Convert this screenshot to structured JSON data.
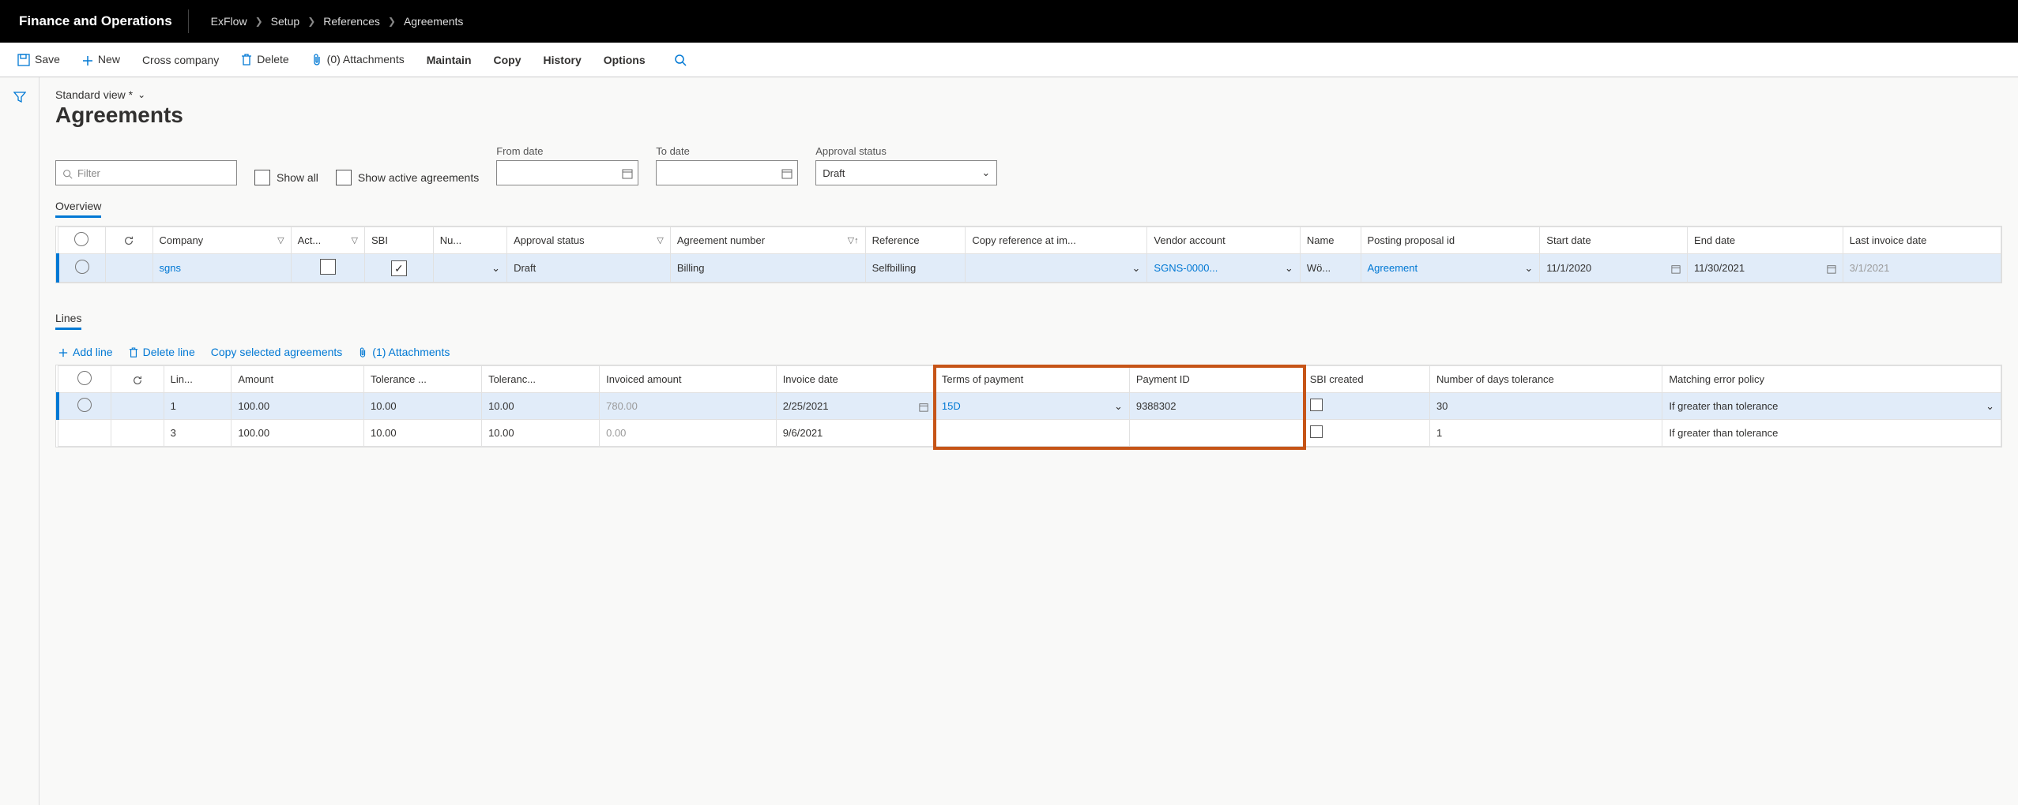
{
  "brand": "Finance and Operations",
  "breadcrumb": [
    "ExFlow",
    "Setup",
    "References",
    "Agreements"
  ],
  "actions": {
    "save": "Save",
    "new": "New",
    "cross_company": "Cross company",
    "delete": "Delete",
    "attachments": "(0) Attachments",
    "maintain": "Maintain",
    "copy": "Copy",
    "history": "History",
    "options": "Options"
  },
  "view_name": "Standard view *",
  "page_title": "Agreements",
  "filters": {
    "filter_placeholder": "Filter",
    "show_all": "Show all",
    "show_active": "Show active agreements",
    "from_date_label": "From date",
    "to_date_label": "To date",
    "approval_status_label": "Approval status",
    "approval_status_value": "Draft"
  },
  "overview": {
    "tab": "Overview",
    "headers": {
      "company": "Company",
      "act": "Act...",
      "sbi": "SBI",
      "nu": "Nu...",
      "approval_status": "Approval status",
      "agreement_number": "Agreement number",
      "reference": "Reference",
      "copy_ref": "Copy reference at im...",
      "vendor_account": "Vendor account",
      "name": "Name",
      "posting_proposal": "Posting proposal id",
      "start_date": "Start date",
      "end_date": "End date",
      "last_invoice_date": "Last invoice date"
    },
    "row": {
      "company": "sgns",
      "act_checked": false,
      "sbi_checked": true,
      "approval_status": "Draft",
      "agreement_number": "Billing",
      "reference": "Selfbilling",
      "vendor_account": "SGNS-0000...",
      "name": "Wö...",
      "posting_proposal": "Agreement",
      "start_date": "11/1/2020",
      "end_date": "11/30/2021",
      "last_invoice_date": "3/1/2021"
    }
  },
  "lines": {
    "tab": "Lines",
    "toolbar": {
      "add_line": "Add line",
      "delete_line": "Delete line",
      "copy_selected": "Copy selected agreements",
      "attachments": "(1) Attachments"
    },
    "headers": {
      "lin": "Lin...",
      "amount": "Amount",
      "tolerance1": "Tolerance ...",
      "tolerance2": "Toleranc...",
      "invoiced_amount": "Invoiced amount",
      "invoice_date": "Invoice date",
      "terms_of_payment": "Terms of payment",
      "payment_id": "Payment ID",
      "sbi_created": "SBI created",
      "days_tolerance": "Number of days tolerance",
      "matching_error": "Matching error policy"
    },
    "rows": [
      {
        "lin": "1",
        "amount": "100.00",
        "tol1": "10.00",
        "tol2": "10.00",
        "invoiced_amount": "780.00",
        "invoice_date": "2/25/2021",
        "terms": "15D",
        "payment_id": "9388302",
        "days_tolerance": "30",
        "matching": "If greater than tolerance"
      },
      {
        "lin": "3",
        "amount": "100.00",
        "tol1": "10.00",
        "tol2": "10.00",
        "invoiced_amount": "0.00",
        "invoice_date": "9/6/2021",
        "terms": "",
        "payment_id": "",
        "days_tolerance": "1",
        "matching": "If greater than tolerance"
      }
    ]
  }
}
